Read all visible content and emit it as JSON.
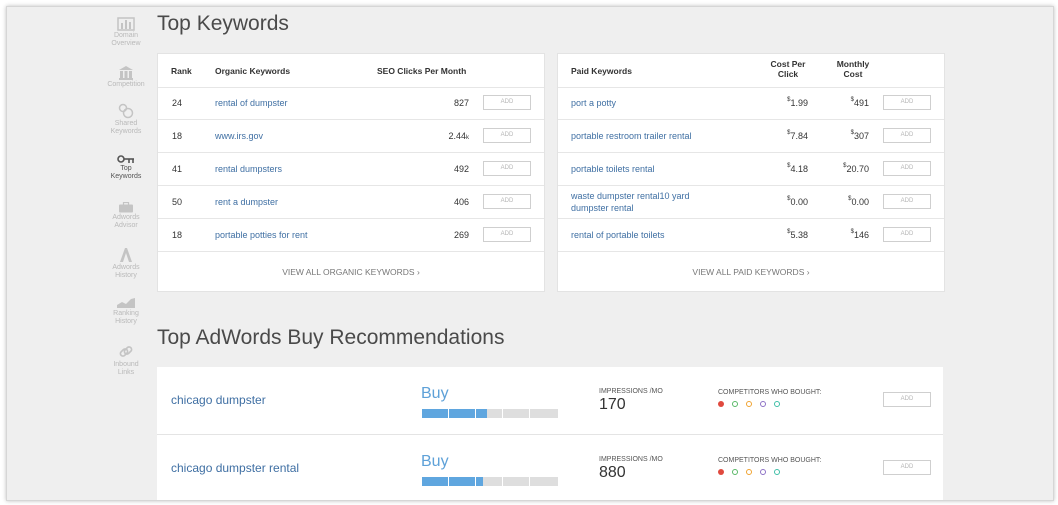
{
  "sidebar": {
    "items": [
      {
        "label_1": "Domain",
        "label_2": "Overview",
        "icon": "bar-chart-icon"
      },
      {
        "label_1": "Competition",
        "label_2": "",
        "icon": "building-icon"
      },
      {
        "label_1": "Shared",
        "label_2": "Keywords",
        "icon": "shared-keywords-icon"
      },
      {
        "label_1": "Top",
        "label_2": "Keywords",
        "icon": "key-icon"
      },
      {
        "label_1": "Adwords",
        "label_2": "Advisor",
        "icon": "briefcase-icon"
      },
      {
        "label_1": "Adwords",
        "label_2": "History",
        "icon": "adwords-history-icon"
      },
      {
        "label_1": "Ranking",
        "label_2": "History",
        "icon": "ranking-chart-icon"
      },
      {
        "label_1": "Inbound",
        "label_2": "Links",
        "icon": "link-icon"
      }
    ]
  },
  "top_keywords": {
    "title": "Top Keywords",
    "organic": {
      "headers": {
        "rank": "Rank",
        "keyword": "Organic Keywords",
        "clicks": "SEO Clicks Per Month"
      },
      "rows": [
        {
          "rank": "24",
          "keyword": "rental of dumpster",
          "clicks": "827",
          "unit": ""
        },
        {
          "rank": "18",
          "keyword": "www.irs.gov",
          "clicks": "2.44",
          "unit": "k"
        },
        {
          "rank": "41",
          "keyword": "rental dumpsters",
          "clicks": "492",
          "unit": ""
        },
        {
          "rank": "50",
          "keyword": "rent a dumpster",
          "clicks": "406",
          "unit": ""
        },
        {
          "rank": "18",
          "keyword": "portable potties for rent",
          "clicks": "269",
          "unit": ""
        }
      ],
      "view_all": "VIEW ALL ORGANIC KEYWORDS ›"
    },
    "paid": {
      "headers": {
        "keyword": "Paid Keywords",
        "cpc_1": "Cost Per",
        "cpc_2": "Click",
        "monthly_1": "Monthly",
        "monthly_2": "Cost"
      },
      "rows": [
        {
          "keyword_1": "port a potty",
          "keyword_2": "",
          "cpc_sym": "$",
          "cpc": "1.99",
          "monthly_sym": "$",
          "monthly": "491"
        },
        {
          "keyword_1": "portable restroom trailer rental",
          "keyword_2": "",
          "cpc_sym": "$",
          "cpc": "7.84",
          "monthly_sym": "$",
          "monthly": "307"
        },
        {
          "keyword_1": "portable toilets rental",
          "keyword_2": "",
          "cpc_sym": "$",
          "cpc": "4.18",
          "monthly_sym": "$",
          "monthly": "20.70"
        },
        {
          "keyword_1": "waste dumpster rental10 yard",
          "keyword_2": "dumpster rental",
          "cpc_sym": "$",
          "cpc": "0.00",
          "monthly_sym": "$",
          "monthly": "0.00"
        },
        {
          "keyword_1": "rental of portable toilets",
          "keyword_2": "",
          "cpc_sym": "$",
          "cpc": "5.38",
          "monthly_sym": "$",
          "monthly": "146"
        }
      ],
      "view_all": "VIEW ALL PAID KEYWORDS ›"
    },
    "add_label": "ADD"
  },
  "recommendations": {
    "title": "Top AdWords Buy Recommendations",
    "impressions_label": "IMPRESSIONS /MO",
    "competitors_label": "COMPETITORS WHO BOUGHT:",
    "add_label": "ADD",
    "rows": [
      {
        "keyword": "chicago dumpster",
        "action": "Buy",
        "bar_fill": 0.48,
        "impressions": "170"
      },
      {
        "keyword": "chicago dumpster rental",
        "action": "Buy",
        "bar_fill": 0.45,
        "impressions": "880"
      }
    ],
    "competitor_dot_colors": [
      "#e0493e",
      "#58b866",
      "#f0a330",
      "#8d72c6",
      "#3fbfa7"
    ]
  }
}
